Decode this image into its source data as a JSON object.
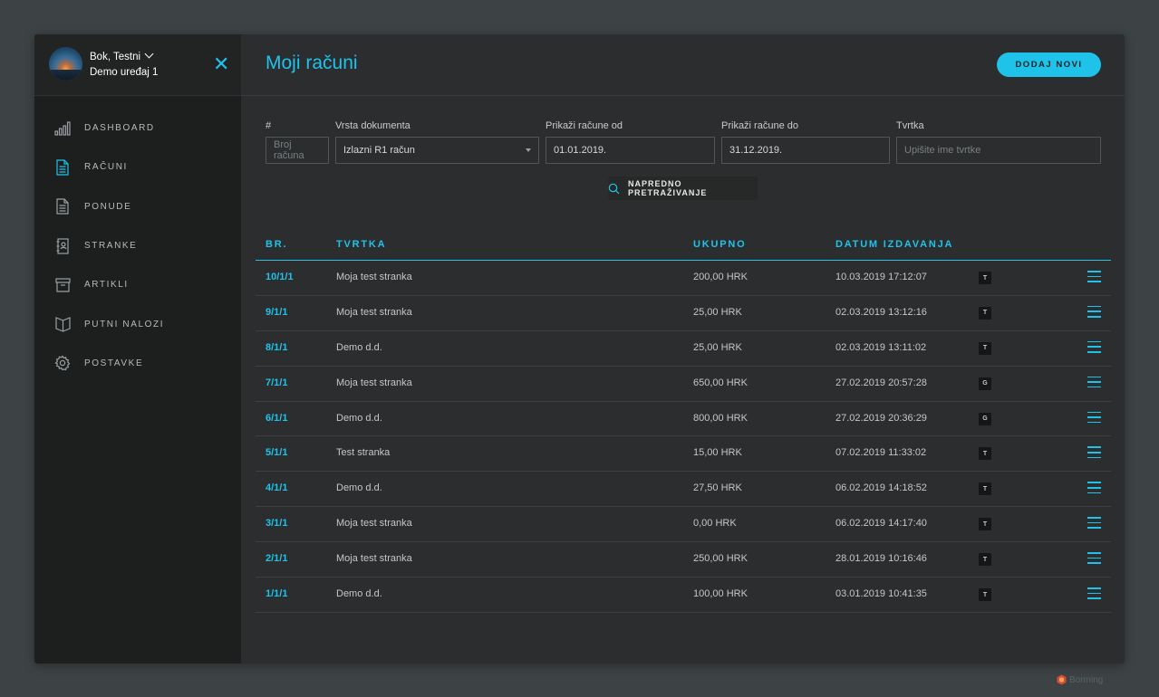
{
  "sidebar": {
    "user_name": "Bok, Testni",
    "device": "Demo uređaj 1",
    "items": [
      {
        "label": "DASHBOARD",
        "icon": "bar-chart-icon"
      },
      {
        "label": "RAČUNI",
        "icon": "invoice-icon"
      },
      {
        "label": "PONUDE",
        "icon": "document-icon"
      },
      {
        "label": "STRANKE",
        "icon": "contacts-book-icon"
      },
      {
        "label": "ARTIKLI",
        "icon": "archive-box-icon"
      },
      {
        "label": "PUTNI NALOZI",
        "icon": "open-book-icon"
      },
      {
        "label": "POSTAVKE",
        "icon": "gear-icon"
      }
    ]
  },
  "header": {
    "title": "Moji računi",
    "add_label": "DODAJ NOVI"
  },
  "filters": {
    "number_label": "#",
    "number_placeholder": "Broj računa",
    "doc_type_label": "Vrsta dokumenta",
    "doc_type_value": "Izlazni R1 račun",
    "from_label": "Prikaži račune od",
    "from_value": "01.01.2019.",
    "to_label": "Prikaži račune do",
    "to_value": "31.12.2019.",
    "company_label": "Tvrtka",
    "company_placeholder": "Upišite ime tvrtke",
    "advanced_label": "NAPREDNO PRETRAŽIVANJE"
  },
  "table": {
    "columns": [
      "BR.",
      "TVRTKA",
      "UKUPNO",
      "DATUM IZDAVANJA"
    ],
    "rows": [
      {
        "num": "10/1/1",
        "company": "Moja test stranka",
        "total": "200,00 HRK",
        "date": "10.03.2019 17:12:07",
        "badge": "T"
      },
      {
        "num": "9/1/1",
        "company": "Moja test stranka",
        "total": "25,00 HRK",
        "date": "02.03.2019 13:12:16",
        "badge": "T"
      },
      {
        "num": "8/1/1",
        "company": "Demo d.d.",
        "total": "25,00 HRK",
        "date": "02.03.2019 13:11:02",
        "badge": "T"
      },
      {
        "num": "7/1/1",
        "company": "Moja test stranka",
        "total": "650,00 HRK",
        "date": "27.02.2019 20:57:28",
        "badge": "G"
      },
      {
        "num": "6/1/1",
        "company": "Demo d.d.",
        "total": "800,00 HRK",
        "date": "27.02.2019 20:36:29",
        "badge": "G"
      },
      {
        "num": "5/1/1",
        "company": "Test stranka",
        "total": "15,00 HRK",
        "date": "07.02.2019 11:33:02",
        "badge": "T"
      },
      {
        "num": "4/1/1",
        "company": "Demo d.d.",
        "total": "27,50 HRK",
        "date": "06.02.2019 14:18:52",
        "badge": "T"
      },
      {
        "num": "3/1/1",
        "company": "Moja test stranka",
        "total": "0,00 HRK",
        "date": "06.02.2019 14:17:40",
        "badge": "T"
      },
      {
        "num": "2/1/1",
        "company": "Moja test stranka",
        "total": "250,00 HRK",
        "date": "28.01.2019 10:16:46",
        "badge": "T"
      },
      {
        "num": "1/1/1",
        "company": "Demo d.d.",
        "total": "100,00 HRK",
        "date": "03.01.2019 10:41:35",
        "badge": "T"
      }
    ]
  },
  "brand": "Borming",
  "colors": {
    "accent": "#1fc3ea",
    "background": "#3d4244",
    "panel": "#2b2d2f",
    "sidebar": "#1d1f1f"
  }
}
